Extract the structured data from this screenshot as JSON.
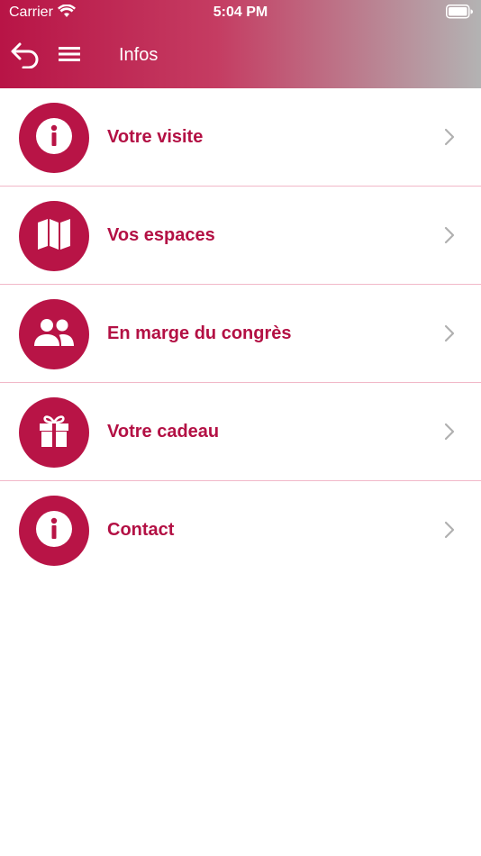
{
  "status_bar": {
    "carrier": "Carrier",
    "time": "5:04 PM"
  },
  "nav": {
    "title": "Infos"
  },
  "colors": {
    "accent": "#b81446",
    "label": "#b31044",
    "divider": "#f1b8c8"
  },
  "items": [
    {
      "label": "Votre visite",
      "icon": "info-icon"
    },
    {
      "label": "Vos espaces",
      "icon": "map-icon"
    },
    {
      "label": "En marge du congrès",
      "icon": "people-icon"
    },
    {
      "label": "Votre cadeau",
      "icon": "gift-icon"
    },
    {
      "label": "Contact",
      "icon": "info-icon"
    }
  ]
}
